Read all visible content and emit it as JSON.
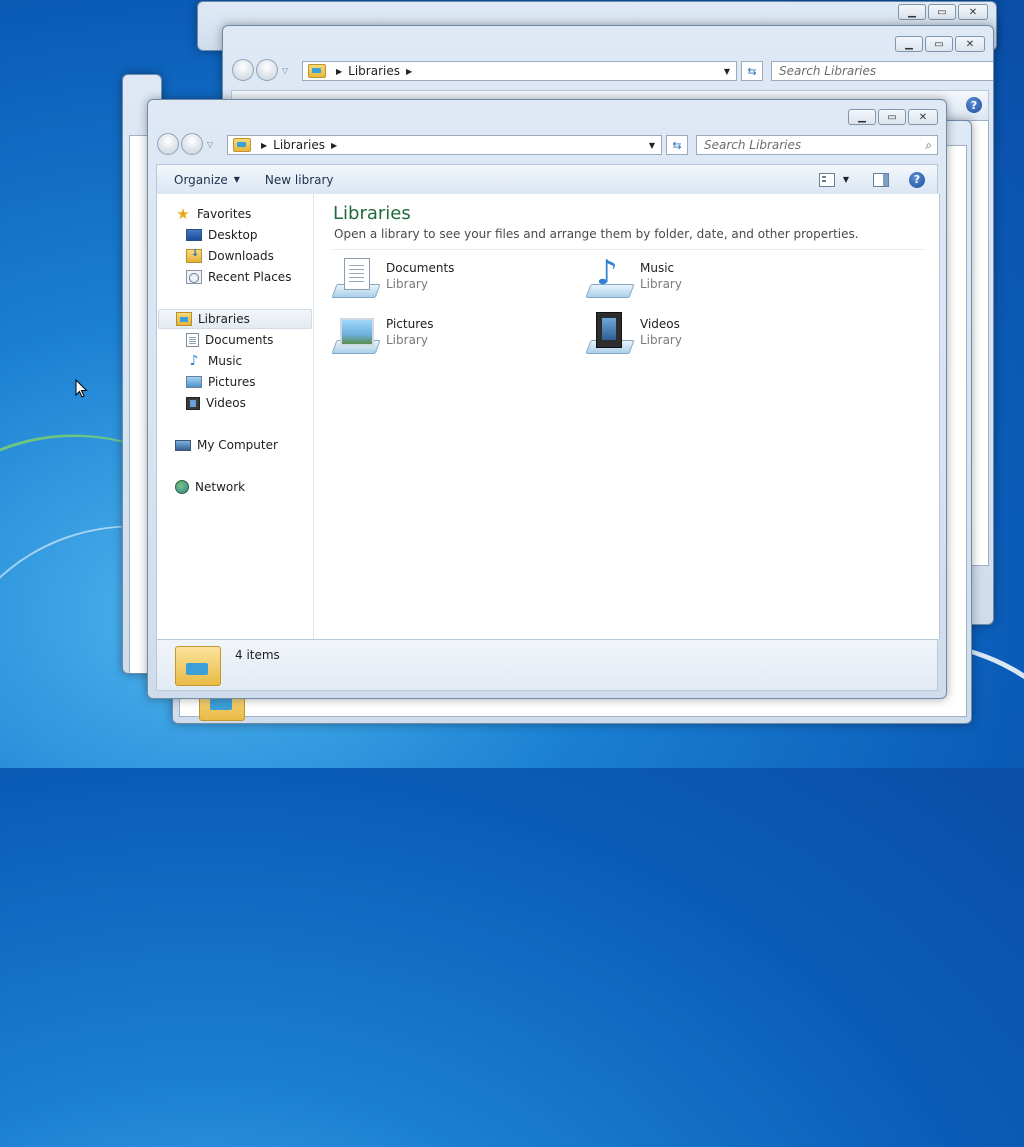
{
  "main_window": {
    "address": {
      "segment": "Libraries"
    },
    "search": {
      "placeholder": "Search Libraries"
    },
    "toolbar": {
      "organize_label": "Organize",
      "new_library_label": "New library"
    },
    "nav": {
      "favorites": "Favorites",
      "desktop": "Desktop",
      "downloads": "Downloads",
      "recent_places": "Recent Places",
      "libraries": "Libraries",
      "documents": "Documents",
      "music": "Music",
      "pictures": "Pictures",
      "videos": "Videos",
      "my_computer": "My Computer",
      "network": "Network"
    },
    "content": {
      "title": "Libraries",
      "subtitle": "Open a library to see your files and arrange them by folder, date, and other properties.",
      "libraries": [
        {
          "name": "Documents",
          "type": "Library"
        },
        {
          "name": "Music",
          "type": "Library"
        },
        {
          "name": "Pictures",
          "type": "Library"
        },
        {
          "name": "Videos",
          "type": "Library"
        }
      ]
    },
    "status": {
      "items": "4 items"
    }
  },
  "mid_window": {
    "address": {
      "segment": "Libraries"
    },
    "search": {
      "placeholder": "Search Libraries"
    }
  },
  "colors": {
    "accent_title": "#1e6a3c",
    "desktop_bg": "#0b5cb8",
    "frame": "#dfe9f5"
  }
}
